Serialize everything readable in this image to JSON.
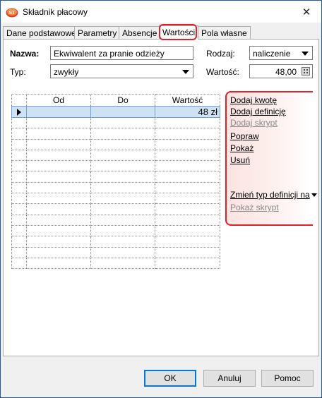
{
  "window": {
    "title": "Składnik płacowy",
    "close_glyph": "✕"
  },
  "tabs": [
    {
      "label": "Dane podstawowe"
    },
    {
      "label": "Parametry"
    },
    {
      "label": "Absencje"
    },
    {
      "label": "Wartości",
      "active": true
    },
    {
      "label": "Pola własne"
    }
  ],
  "form": {
    "nazwa_label": "Nazwa:",
    "nazwa_value": "Ekwiwalent za pranie odzieży",
    "typ_label": "Typ:",
    "typ_value": "zwykły",
    "rodzaj_label": "Rodzaj:",
    "rodzaj_value": "naliczenie",
    "wartosc_label": "Wartość:",
    "wartosc_value": "48,00"
  },
  "grid": {
    "columns": [
      "Od",
      "Do",
      "Wartość"
    ],
    "rows": [
      {
        "od": "",
        "do": "",
        "wartosc": "48 zł",
        "selected": true
      }
    ],
    "empty_rows": 14
  },
  "actions": {
    "dodaj_kwote": "Dodaj kwotę",
    "dodaj_definicje": "Dodaj definicję",
    "dodaj_skrypt": "Dodaj skrypt",
    "popraw": "Popraw",
    "pokaz": "Pokaż",
    "usun": "Usuń",
    "zmien_typ": "Zmień typ definicji na",
    "pokaz_skrypt": "Pokaż skrypt"
  },
  "buttons": {
    "ok": "OK",
    "anuluj": "Anuluj",
    "pomoc": "Pomoc"
  },
  "colors": {
    "highlight": "#e0202a",
    "selection": "#cfe2f3",
    "accent": "#0078d7"
  },
  "icons": [
    "app-icon",
    "close-icon",
    "dropdown-arrow-icon",
    "calculator-icon",
    "row-pointer-icon"
  ]
}
